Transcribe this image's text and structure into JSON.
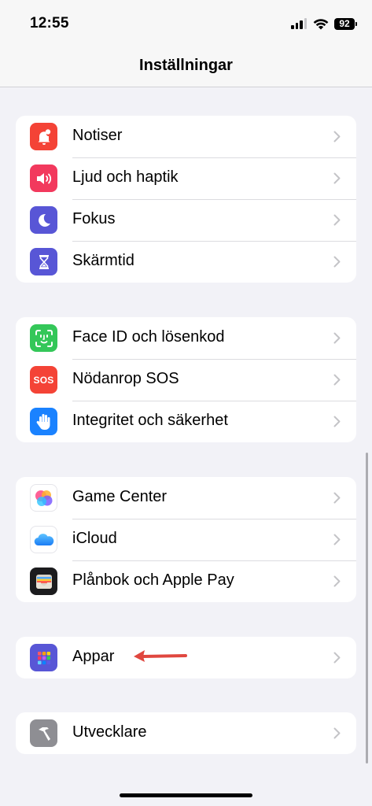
{
  "status_bar": {
    "time": "12:55",
    "battery": "92"
  },
  "nav": {
    "title": "Inställningar"
  },
  "groups": [
    {
      "items": [
        {
          "label": "Notiser",
          "icon": "bell-badge-icon",
          "color": "#f44336"
        },
        {
          "label": "Ljud och haptik",
          "icon": "speaker-icon",
          "color": "#f2395d"
        },
        {
          "label": "Fokus",
          "icon": "moon-icon",
          "color": "#5856d6"
        },
        {
          "label": "Skärmtid",
          "icon": "hourglass-icon",
          "color": "#5856d6"
        }
      ]
    },
    {
      "items": [
        {
          "label": "Face ID och lösenkod",
          "icon": "face-id-icon",
          "color": "#34c759"
        },
        {
          "label": "Nödanrop SOS",
          "icon": "sos-icon",
          "icon_text": "SOS",
          "color": "#f44336"
        },
        {
          "label": "Integritet och säkerhet",
          "icon": "hand-icon",
          "color": "#1a82ff"
        }
      ]
    },
    {
      "items": [
        {
          "label": "Game Center",
          "icon": "game-center-icon",
          "color": "#ffffff"
        },
        {
          "label": "iCloud",
          "icon": "cloud-icon",
          "color": "#ffffff"
        },
        {
          "label": "Plånbok och Apple Pay",
          "icon": "wallet-icon",
          "color": "#1c1c1e"
        }
      ]
    },
    {
      "items": [
        {
          "label": "Appar",
          "icon": "apps-grid-icon",
          "color": "#5856d6"
        }
      ]
    },
    {
      "items": [
        {
          "label": "Utvecklare",
          "icon": "hammer-icon",
          "color": "#8e8e93"
        }
      ]
    }
  ],
  "annotation": {
    "arrow_color": "#e0473f"
  }
}
